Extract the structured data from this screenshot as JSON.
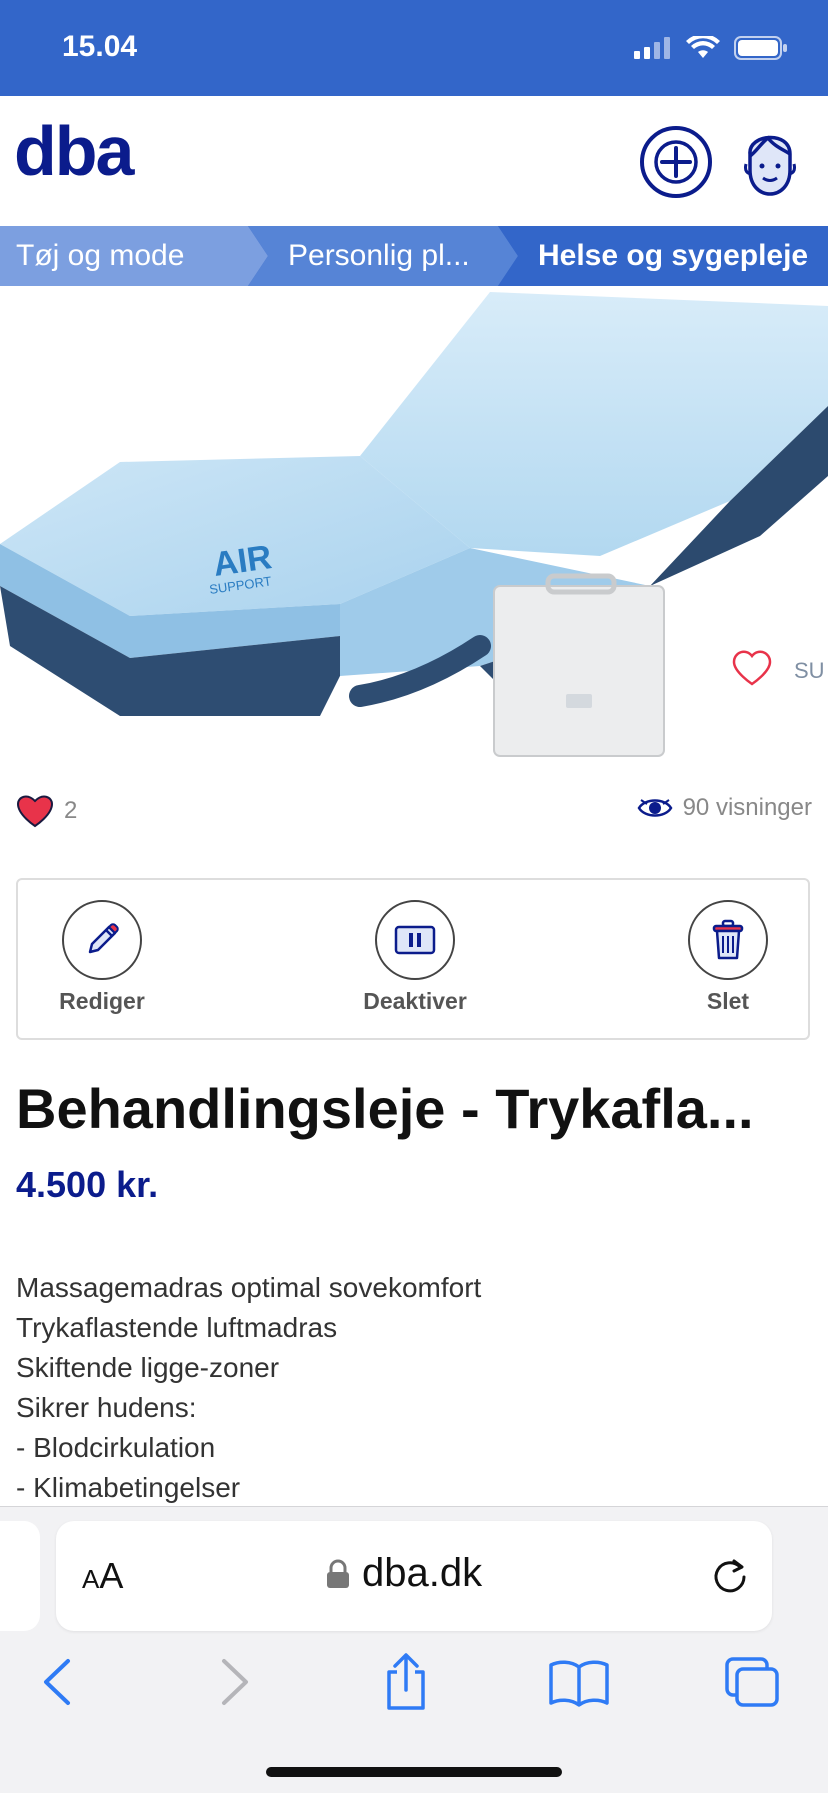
{
  "status_bar": {
    "time": "15.04",
    "signal_icon": "cellular-signal-icon",
    "wifi_icon": "wifi-icon",
    "battery_icon": "battery-icon"
  },
  "header": {
    "logo": "dba",
    "add_icon": "plus-circle-icon",
    "profile_icon": "user-face-icon"
  },
  "breadcrumb": [
    {
      "label": "Tøj og mode"
    },
    {
      "label": "Personlig pl..."
    },
    {
      "label": "Helse og sygepleje"
    }
  ],
  "listing": {
    "image_alt": "Blue air mattress with white pump unit",
    "favorites_count": "2",
    "views": "90 visninger",
    "title": "Behandlingsleje - Trykafla...",
    "price": "4.500 kr.",
    "description": [
      "Massagemadras optimal sovekomfort",
      "Trykaflastende luftmadras",
      "Skiftende ligge-zoner",
      "Sikrer hudens:",
      "- Blodcirkulation",
      "- Klimabetingelser"
    ]
  },
  "actions": [
    {
      "label": "Rediger",
      "icon": "pencil-icon"
    },
    {
      "label": "Deaktiver",
      "icon": "pause-icon"
    },
    {
      "label": "Slet",
      "icon": "trash-icon"
    }
  ],
  "browser": {
    "text_size_label_big": "A",
    "text_size_label_small": "A",
    "url": "dba.dk",
    "icons": [
      "back-icon",
      "forward-icon",
      "share-icon",
      "bookmarks-icon",
      "tabs-icon"
    ]
  },
  "colors": {
    "brand_blue": "#3366c9",
    "dba_navy": "#0b1c8c",
    "heart_red": "#e8334a"
  }
}
